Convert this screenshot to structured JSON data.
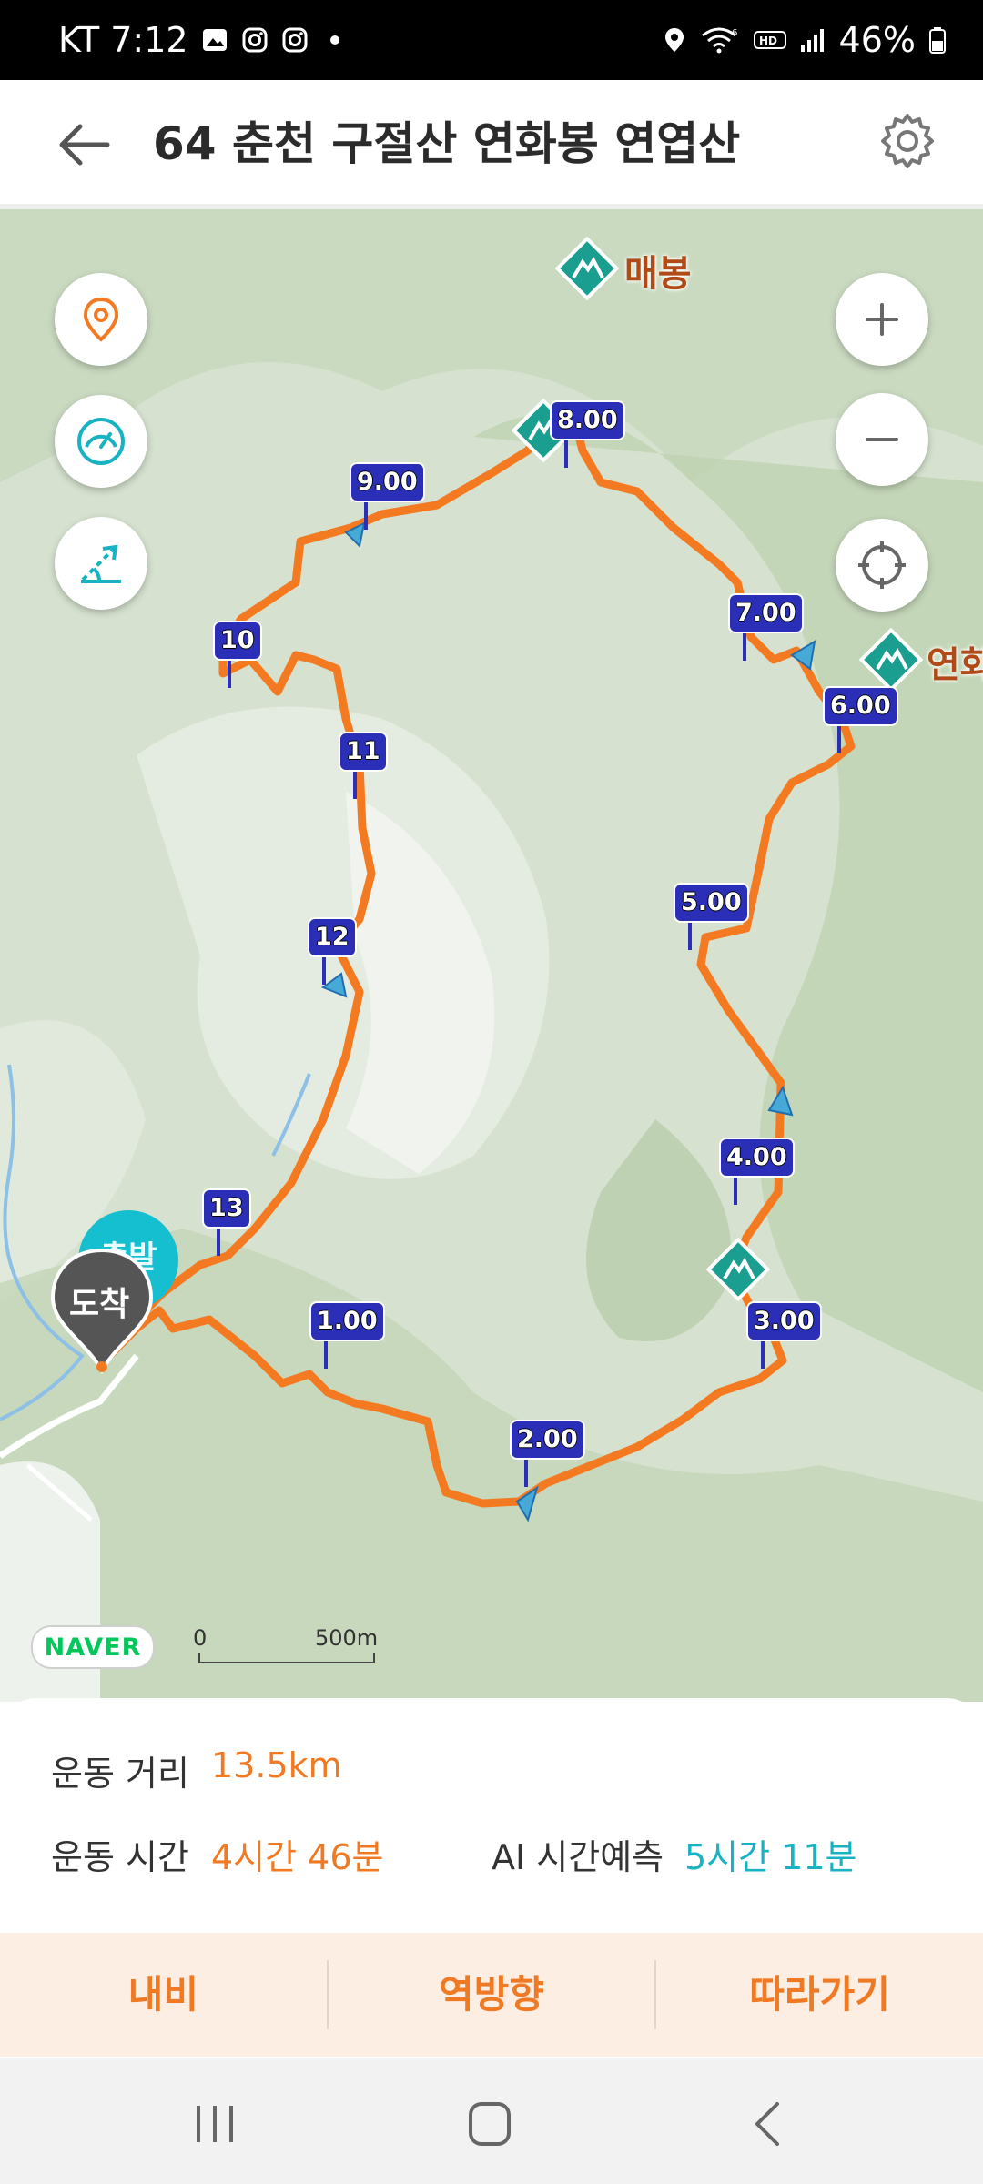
{
  "status_bar": {
    "carrier_time": "KT 7:12",
    "battery": "46%",
    "left_icons": [
      "gallery-icon",
      "instagram-icon",
      "instagram-icon",
      "dot-icon"
    ],
    "right_icons": [
      "location-icon",
      "wifi-6-icon",
      "hd-icon",
      "signal-icon",
      "battery-icon"
    ]
  },
  "header": {
    "title": "64 춘천 구절산 연화봉 연엽산",
    "back_icon": "back-arrow-icon",
    "settings_icon": "gear-icon"
  },
  "map": {
    "peaks": [
      {
        "name": "매봉"
      },
      {
        "name": "연화"
      }
    ],
    "markers": {
      "start": "출발",
      "finish": "도착"
    },
    "km_markers": [
      "1.00",
      "2.00",
      "3.00",
      "4.00",
      "5.00",
      "6.00",
      "7.00",
      "8.00",
      "9.00",
      "10",
      "11",
      "12",
      "13"
    ],
    "naver_logo": "NAVER",
    "scale": {
      "zero": "0",
      "distance": "500m"
    },
    "controls": {
      "left": [
        "location-pin-icon",
        "speedometer-icon",
        "elevation-icon"
      ],
      "right": [
        "zoom-in-icon",
        "zoom-out-icon",
        "crosshair-icon"
      ]
    },
    "colors": {
      "route": "#f47a22",
      "marker": "#2b2fb8",
      "peak": "#1a9e8f",
      "peak_label": "#b04a16"
    }
  },
  "summary": {
    "distance_label": "운동 거리",
    "distance_value": "13.5km",
    "time_label": "운동 시간",
    "time_value": "4시간 46분",
    "ai_label": "AI 시간예측",
    "ai_value": "5시간 11분"
  },
  "actions": {
    "navi": "내비",
    "reverse": "역방향",
    "follow": "따라가기"
  },
  "nav_bar": [
    "recent-apps-icon",
    "home-icon",
    "back-icon"
  ]
}
